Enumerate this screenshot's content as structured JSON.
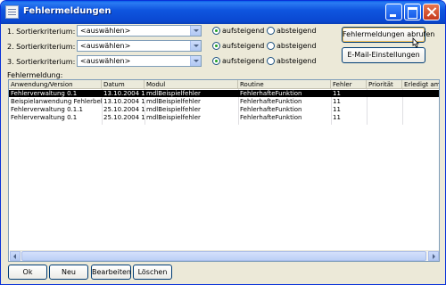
{
  "window": {
    "title": "Fehlermeldungen"
  },
  "sort": {
    "rows": [
      {
        "label": "1. Sortierkriterium:",
        "value": "<auswählen>",
        "asc": "aufsteigend",
        "desc": "absteigend",
        "selected": "asc"
      },
      {
        "label": "2. Sortierkriterium:",
        "value": "<auswählen>",
        "asc": "aufsteigend",
        "desc": "absteigend",
        "selected": "asc"
      },
      {
        "label": "3. Sortierkriterium:",
        "value": "<auswählen>",
        "asc": "aufsteigend",
        "desc": "absteigend",
        "selected": "asc"
      }
    ]
  },
  "buttons": {
    "fetch": "Fehlermeldungen abrufen",
    "email_settings": "E-Mail-Einstellungen",
    "ok": "Ok",
    "new": "Neu",
    "edit": "Bearbeiten",
    "delete": "Löschen"
  },
  "list": {
    "label": "Fehlermeldung:",
    "columns": [
      "Anwendung/Version",
      "Datum",
      "Modul",
      "Routine",
      "Fehler",
      "Priorität",
      "Erledigt am"
    ],
    "rows": [
      [
        "Fehlerverwaltung 0.1",
        "13.10.2004 1",
        "mdlBeispielfehler",
        "FehlerhafteFunktion",
        "11",
        "",
        ""
      ],
      [
        "Beispielanwendung Fehlerbehe",
        "13.10.2004 1",
        "mdlBeispielfehler",
        "FehlerhafteFunktion",
        "11",
        "",
        ""
      ],
      [
        "Fehlerverwaltung 0.1.1",
        "25.10.2004 1",
        "mdlBeispielfehler",
        "FehlerhafteFunktion",
        "11",
        "",
        ""
      ],
      [
        "Fehlerverwaltung 0.1",
        "25.10.2004 1",
        "mdlBeispielfehler",
        "FehlerhafteFunktion",
        "11",
        "",
        ""
      ]
    ],
    "selected_row": 0
  },
  "icons": {
    "app": "app-icon",
    "minimize": "minimize-icon",
    "maximize": "maximize-icon",
    "close": "close-icon",
    "dropdown": "chevron-down-icon",
    "cursor": "mouse-pointer-icon"
  },
  "colors": {
    "titlebar": "#0a48d1",
    "window_bg": "#ece9d8",
    "selection": "#000000",
    "radio_dot": "#21a121"
  }
}
